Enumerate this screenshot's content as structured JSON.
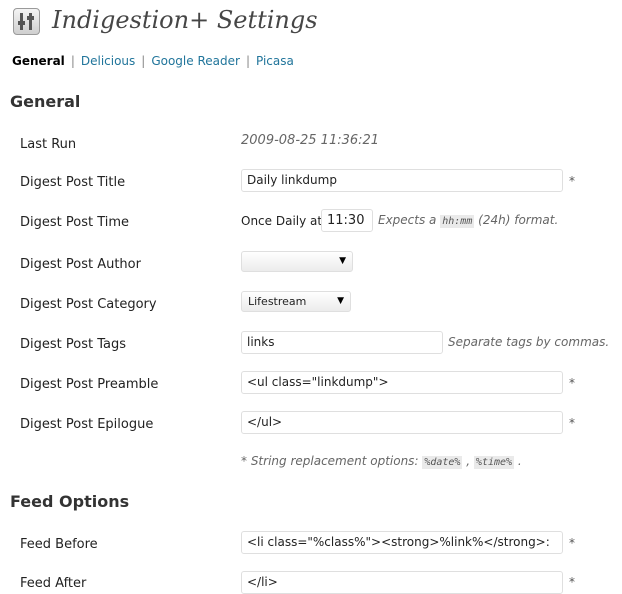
{
  "page": {
    "title": "Indigestion+ Settings"
  },
  "subnav": {
    "current": "General",
    "links": [
      "Delicious",
      "Google Reader",
      "Picasa"
    ],
    "separator": "|"
  },
  "general": {
    "heading": "General",
    "last_run": {
      "label": "Last Run",
      "value": "2009-08-25 11:36:21"
    },
    "post_title": {
      "label": "Digest Post Title",
      "value": "Daily linkdump",
      "required": "*"
    },
    "post_time": {
      "label": "Digest Post Time",
      "prefix": "Once Daily at",
      "value": "11:30",
      "hint_before": "Expects a",
      "hint_code": "hh:mm",
      "hint_after": "(24h) format."
    },
    "post_author": {
      "label": "Digest Post Author",
      "selected": ""
    },
    "post_category": {
      "label": "Digest Post Category",
      "selected": "Lifestream"
    },
    "post_tags": {
      "label": "Digest Post Tags",
      "value": "links",
      "hint": "Separate tags by commas."
    },
    "post_preamble": {
      "label": "Digest Post Preamble",
      "value": "<ul class=\"linkdump\">",
      "required": "*"
    },
    "post_epilogue": {
      "label": "Digest Post Epilogue",
      "value": "</ul>",
      "required": "*"
    },
    "replacement_note": {
      "text": "* String replacement options:",
      "opt1": "%date%",
      "comma": ",",
      "opt2": "%time%",
      "end": "."
    }
  },
  "feed": {
    "heading": "Feed Options",
    "before": {
      "label": "Feed Before",
      "value": "<li class=\"%class%\"><strong>%link%</strong>:",
      "required": "*"
    },
    "after": {
      "label": "Feed After",
      "value": "</li>",
      "required": "*"
    }
  },
  "colors": {
    "link": "#21759b",
    "hint": "#666666",
    "input_border": "#dfdfdf"
  },
  "icons": {
    "title_icon": "settings-sliders-icon",
    "dropdown": "chevron-down-icon"
  }
}
